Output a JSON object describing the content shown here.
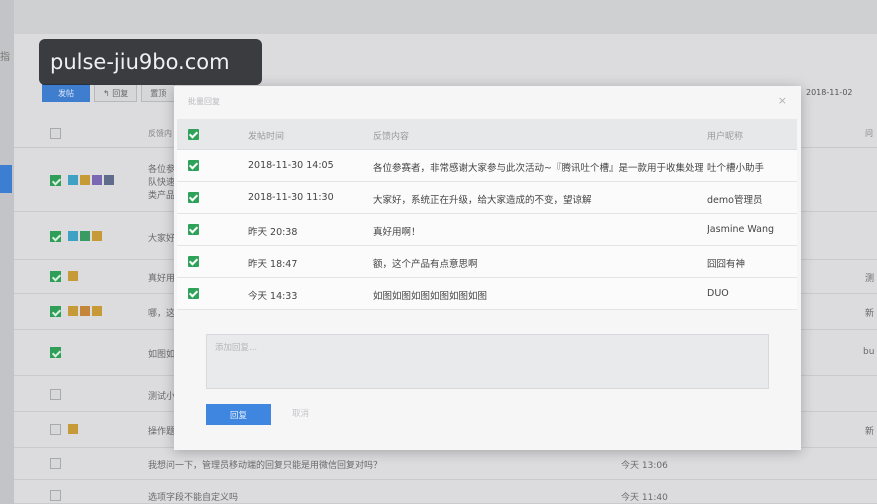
{
  "watermark": "pulse-jiu9bo.com",
  "background": {
    "sidebar_char": "指",
    "toolbar": {
      "publish": "发帖",
      "reply": "回复",
      "more": "置顶"
    },
    "date": "2018-11-02",
    "col_feedback": "反馈内",
    "col_right": "问",
    "rows": [
      {
        "text": "各位参",
        "checked": true
      },
      {
        "text": "队快速",
        "checked": false
      },
      {
        "text": "类产品",
        "checked": false
      },
      {
        "text": "大家好",
        "checked": true
      },
      {
        "text": "真好用",
        "checked": true
      },
      {
        "text": "哪，这",
        "checked": true
      },
      {
        "text": "如图如",
        "checked": true
      },
      {
        "text": "测试小",
        "checked": false
      },
      {
        "text": "操作题",
        "checked": false
      },
      {
        "text": "我想问一下，管理员移动端的回复只能是用微信回复对吗？",
        "time": "今天 13:06"
      },
      {
        "text": "选项字段不能自定义吗",
        "time": "今天 11:40"
      }
    ],
    "right_labels": [
      "测",
      "新",
      "bu",
      "新"
    ]
  },
  "modal": {
    "title": "批量回复",
    "close": "×",
    "columns": {
      "time": "发帖时间",
      "content": "反馈内容",
      "user": "用户昵称"
    },
    "rows": [
      {
        "time": "2018-11-30 14:05",
        "content": "各位参赛者，非常感谢大家参与此次活动~『腾讯吐个槽』是一款用于收集处理...",
        "user": "吐个槽小助手"
      },
      {
        "time": "2018-11-30 11:30",
        "content": "大家好，系统正在升级，给大家造成的不变，望谅解",
        "user": "demo管理员"
      },
      {
        "time": "昨天 20:38",
        "content": "真好用啊！",
        "user": "Jasmine Wang"
      },
      {
        "time": "昨天 18:47",
        "content": "额，这个产品有点意思啊",
        "user": "囧囧有神"
      },
      {
        "time": "今天 14:33",
        "content": "如图如图如图如图如图如图",
        "user": "DUO"
      }
    ],
    "reply_placeholder": "添加回复...",
    "reply_button": "回复",
    "cancel_button": "取消"
  },
  "colors": {
    "accent": "#3e86e0",
    "check": "#2fa25a"
  }
}
